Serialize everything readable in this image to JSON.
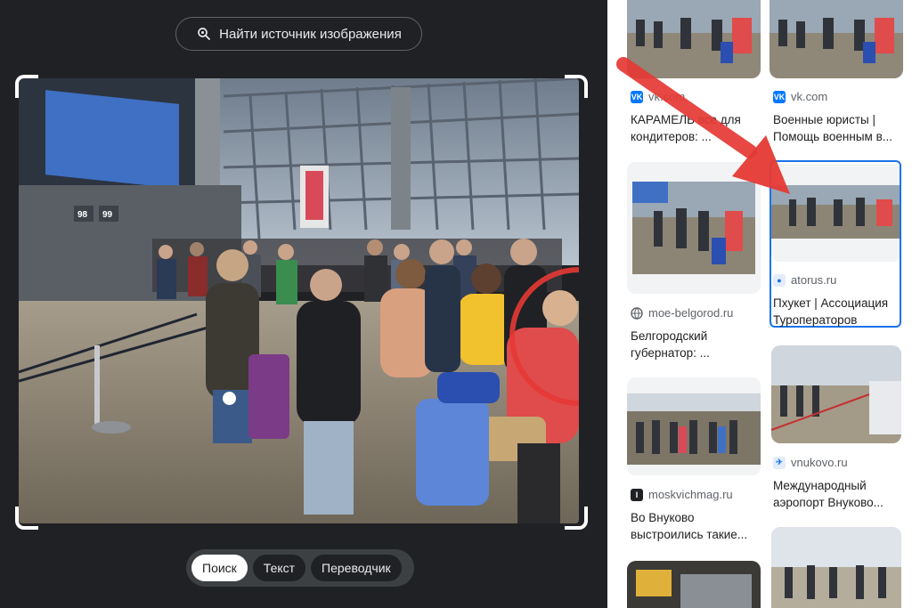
{
  "left": {
    "find_source_label": "Найти источник изображения",
    "tabs": [
      {
        "label": "Поиск",
        "active": true
      },
      {
        "label": "Текст",
        "active": false
      },
      {
        "label": "Переводчик",
        "active": false
      }
    ],
    "photo_signs": {
      "gate_a": "98",
      "gate_b": "99"
    }
  },
  "results": [
    {
      "source": "vk.com",
      "title": "КАРАМЕЛЬ все для кондитеров: ...",
      "icon": "vk-icon"
    },
    {
      "source": "vk.com",
      "title": "Военные юристы | Помощь военным в...",
      "icon": "vk-icon"
    },
    {
      "source": "moe-belgorod.ru",
      "title": "Белгородский губернатор: ...",
      "icon": "globe-icon"
    },
    {
      "source": "atorus.ru",
      "title": "Пхукет | Ассоциация Туроператоров",
      "icon": "atorus-icon"
    },
    {
      "source": "moskvichmag.ru",
      "title": "Во Внуково выстроились такие...",
      "icon": "moskvichmag-icon"
    },
    {
      "source": "vnukovo.ru",
      "title": "Международный аэропорт Внуково...",
      "icon": "vnukovo-icon"
    }
  ],
  "colors": {
    "accent": "#1a73e8",
    "annotation_red": "#e53935",
    "vk": "#0077ff"
  }
}
